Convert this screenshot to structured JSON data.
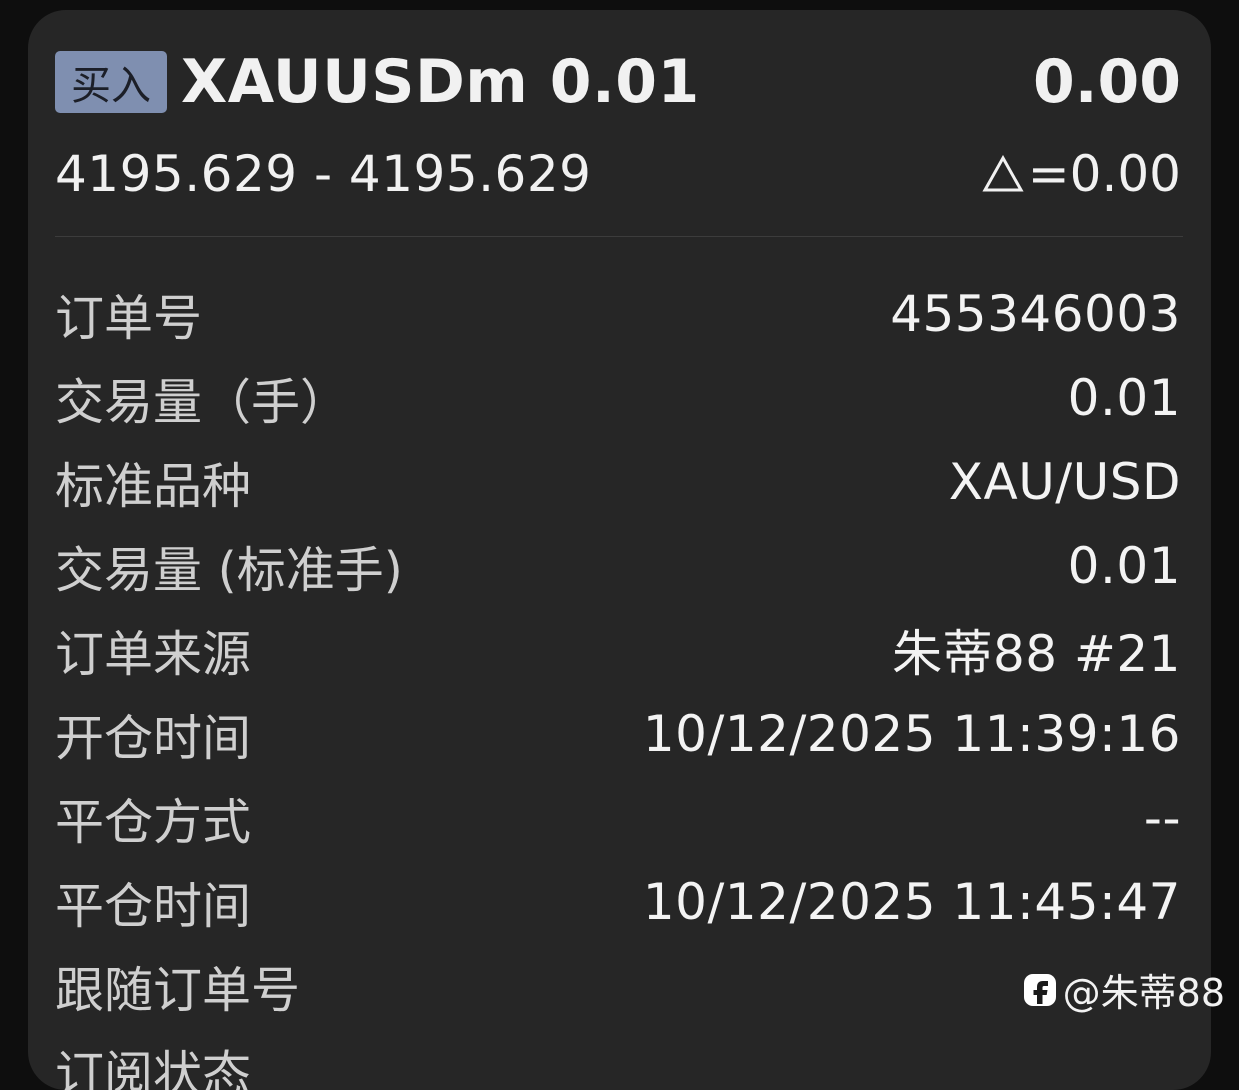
{
  "order": {
    "side_badge": "买入",
    "symbol_volume": "XAUUSDm 0.01",
    "profit": "0.00",
    "price_range": "4195.629 - 4195.629",
    "delta": "=0.00"
  },
  "details": [
    {
      "label": "订单号",
      "value": "455346003"
    },
    {
      "label": "交易量（手）",
      "value": "0.01"
    },
    {
      "label": "标准品种",
      "value": "XAU/USD"
    },
    {
      "label": "交易量 (标准手)",
      "value": "0.01"
    },
    {
      "label": "订单来源",
      "value": "朱蒂88 #21"
    },
    {
      "label": "开仓时间",
      "value": "10/12/2025 11:39:16"
    },
    {
      "label": "平仓方式",
      "value": "--"
    },
    {
      "label": "平仓时间",
      "value": "10/12/2025 11:45:47"
    },
    {
      "label": "跟随订单号",
      "value": ""
    },
    {
      "label": "订阅状态",
      "value": ""
    }
  ],
  "watermark": {
    "text": "@朱蒂88",
    "icon": "brand-logo-icon"
  },
  "colors": {
    "background": "#0e0e0e",
    "card": "#262626",
    "badge": "#7f8fb0"
  }
}
